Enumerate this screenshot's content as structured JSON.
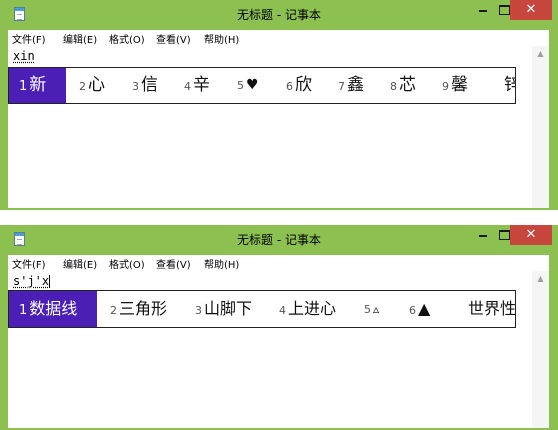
{
  "window_title": "无标题 - 记事本",
  "menu": [
    "文件(F)",
    "编辑(E)",
    "格式(O)",
    "查看(V)",
    "帮助(H)"
  ],
  "controls": {
    "minimize": "－",
    "maximize": "□",
    "close": "✕"
  },
  "colors": {
    "titlebar": "#8cc152",
    "selected_candidate": "#4b1fb5",
    "close": "#c7463d"
  },
  "windows": [
    {
      "typed_text": "xin",
      "candidates": [
        {
          "num": "1",
          "text": "新",
          "selected": true
        },
        {
          "num": "2",
          "text": "心"
        },
        {
          "num": "3",
          "text": "信"
        },
        {
          "num": "4",
          "text": "辛"
        },
        {
          "num": "5",
          "text": "♥"
        },
        {
          "num": "6",
          "text": "欣"
        },
        {
          "num": "7",
          "text": "鑫"
        },
        {
          "num": "8",
          "text": "芯"
        },
        {
          "num": "9",
          "text": "馨"
        },
        {
          "num": "",
          "text": "锌"
        }
      ]
    },
    {
      "typed_text": "s'j'x",
      "candidates": [
        {
          "num": "1",
          "text": "数据线",
          "selected": true
        },
        {
          "num": "2",
          "text": "三角形"
        },
        {
          "num": "3",
          "text": "山脚下"
        },
        {
          "num": "4",
          "text": "上进心"
        },
        {
          "num": "5",
          "text": "▵"
        },
        {
          "num": "6",
          "text": "▲"
        },
        {
          "num": "",
          "text": "世界性"
        }
      ]
    }
  ]
}
